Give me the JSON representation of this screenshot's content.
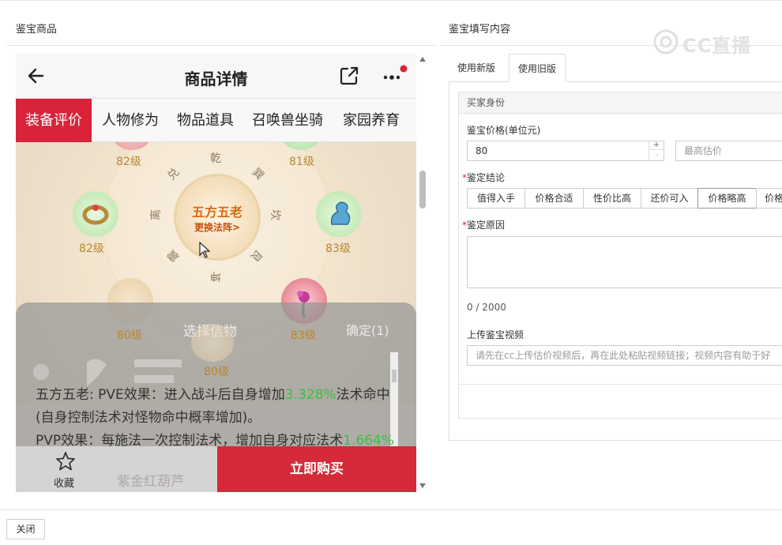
{
  "left_panel": {
    "title": "鉴宝商品"
  },
  "right_panel": {
    "title": "鉴宝填写内容"
  },
  "watermark": "CC直播",
  "phone": {
    "header_title": "商品详情",
    "tabs": [
      "装备评价",
      "人物修为",
      "物品道具",
      "召唤兽坐骑",
      "家园养育"
    ],
    "formation": {
      "name": "五方五老",
      "switch_label": "更换法阵>",
      "trigrams": [
        "乾",
        "巽",
        "坎",
        "艮",
        "坤",
        "震",
        "离",
        "兑"
      ],
      "levels": [
        "82级",
        "81级",
        "82级",
        "83级",
        "80级",
        "83级",
        "80级"
      ]
    },
    "overlay": {
      "title": "选择信物",
      "confirm": "确定(1)"
    },
    "description": {
      "line1_prefix": "五方五老: PVE效果：进入战斗后自身增加",
      "line1_value": "3.328%",
      "line1_suffix": "法术命中",
      "line2": "(自身控制法术对怪物命中概率增加)。",
      "line3_prefix": "PVP效果：每施法一次控制法术，增加自身对应法术",
      "line3_value": "1.664%"
    },
    "bottom": {
      "favorite_label": "收藏",
      "ghost_text": "紫金红葫芦",
      "buy_label": "立即购买"
    }
  },
  "form": {
    "tabs": [
      "使用新版",
      "使用旧版"
    ],
    "active_tab": "使用旧版",
    "section_title": "买家身份",
    "price_label": "鉴宝价格(单位元)",
    "price_value": "80",
    "max_estimate_placeholder": "最高估价",
    "conclusion_label": "鉴定结论",
    "conclusion_options": [
      "值得入手",
      "价格合适",
      "性价比高",
      "还价可入",
      "价格略高",
      "价格"
    ],
    "reason_label": "鉴定原因",
    "char_count": "0 / 2000",
    "video_label": "上传鉴宝视频",
    "video_placeholder": "请先在cc上传估价视频后，再在此处粘贴视频链接；视频内容有助于好"
  },
  "footer": {
    "close_label": "关闭"
  }
}
